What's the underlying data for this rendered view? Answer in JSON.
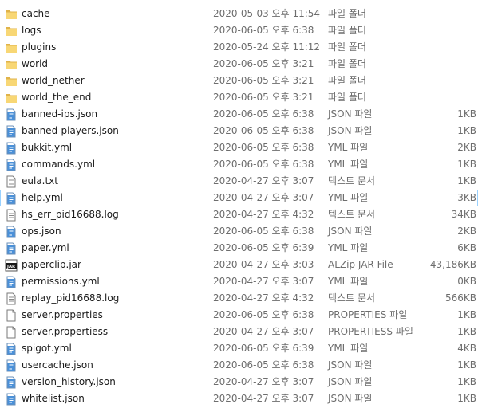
{
  "files": [
    {
      "name": "cache",
      "date": "2020-05-03 오후 11:54",
      "type": "파일 폴더",
      "size": "",
      "icon": "folder-icon"
    },
    {
      "name": "logs",
      "date": "2020-06-05 오후 6:38",
      "type": "파일 폴더",
      "size": "",
      "icon": "folder-icon"
    },
    {
      "name": "plugins",
      "date": "2020-05-24 오후 11:12",
      "type": "파일 폴더",
      "size": "",
      "icon": "folder-icon"
    },
    {
      "name": "world",
      "date": "2020-06-05 오후 3:21",
      "type": "파일 폴더",
      "size": "",
      "icon": "folder-icon"
    },
    {
      "name": "world_nether",
      "date": "2020-06-05 오후 3:21",
      "type": "파일 폴더",
      "size": "",
      "icon": "folder-icon"
    },
    {
      "name": "world_the_end",
      "date": "2020-06-05 오후 3:21",
      "type": "파일 폴더",
      "size": "",
      "icon": "folder-icon"
    },
    {
      "name": "banned-ips.json",
      "date": "2020-06-05 오후 6:38",
      "type": "JSON 파일",
      "size": "1KB",
      "icon": "json-file-icon"
    },
    {
      "name": "banned-players.json",
      "date": "2020-06-05 오후 6:38",
      "type": "JSON 파일",
      "size": "1KB",
      "icon": "json-file-icon"
    },
    {
      "name": "bukkit.yml",
      "date": "2020-06-05 오후 6:38",
      "type": "YML 파일",
      "size": "2KB",
      "icon": "yml-file-icon"
    },
    {
      "name": "commands.yml",
      "date": "2020-06-05 오후 6:38",
      "type": "YML 파일",
      "size": "1KB",
      "icon": "yml-file-icon"
    },
    {
      "name": "eula.txt",
      "date": "2020-04-27 오후 3:07",
      "type": "텍스트 문서",
      "size": "1KB",
      "icon": "text-file-icon"
    },
    {
      "name": "help.yml",
      "date": "2020-04-27 오후 3:07",
      "type": "YML 파일",
      "size": "3KB",
      "icon": "yml-file-icon",
      "focused": true
    },
    {
      "name": "hs_err_pid16688.log",
      "date": "2020-04-27 오후 4:32",
      "type": "텍스트 문서",
      "size": "34KB",
      "icon": "text-file-icon"
    },
    {
      "name": "ops.json",
      "date": "2020-06-05 오후 6:38",
      "type": "JSON 파일",
      "size": "2KB",
      "icon": "json-file-icon"
    },
    {
      "name": "paper.yml",
      "date": "2020-06-05 오후 6:39",
      "type": "YML 파일",
      "size": "6KB",
      "icon": "yml-file-icon"
    },
    {
      "name": "paperclip.jar",
      "date": "2020-04-27 오후 3:03",
      "type": "ALZip JAR File",
      "size": "43,186KB",
      "icon": "jar-file-icon"
    },
    {
      "name": "permissions.yml",
      "date": "2020-04-27 오후 3:07",
      "type": "YML 파일",
      "size": "0KB",
      "icon": "yml-file-icon"
    },
    {
      "name": "replay_pid16688.log",
      "date": "2020-04-27 오후 4:32",
      "type": "텍스트 문서",
      "size": "566KB",
      "icon": "text-file-icon"
    },
    {
      "name": "server.properties",
      "date": "2020-06-05 오후 6:38",
      "type": "PROPERTIES 파일",
      "size": "1KB",
      "icon": "blank-file-icon"
    },
    {
      "name": "server.propertiess",
      "date": "2020-04-27 오후 3:07",
      "type": "PROPERTIESS 파일",
      "size": "1KB",
      "icon": "blank-file-icon"
    },
    {
      "name": "spigot.yml",
      "date": "2020-06-05 오후 6:39",
      "type": "YML 파일",
      "size": "4KB",
      "icon": "yml-file-icon"
    },
    {
      "name": "usercache.json",
      "date": "2020-06-05 오후 6:38",
      "type": "JSON 파일",
      "size": "1KB",
      "icon": "json-file-icon"
    },
    {
      "name": "version_history.json",
      "date": "2020-04-27 오후 3:07",
      "type": "JSON 파일",
      "size": "1KB",
      "icon": "json-file-icon"
    },
    {
      "name": "whitelist.json",
      "date": "2020-04-27 오후 3:07",
      "type": "JSON 파일",
      "size": "1KB",
      "icon": "json-file-icon"
    }
  ],
  "jar_badge": "JAR",
  "colors": {
    "folder": "#f8d775",
    "folder_dark": "#e0b34a",
    "doc_blue": "#4a90d9",
    "selection": "#cce8ff",
    "focus_border": "#99d1ff",
    "detail_text": "#6d6d6d"
  }
}
